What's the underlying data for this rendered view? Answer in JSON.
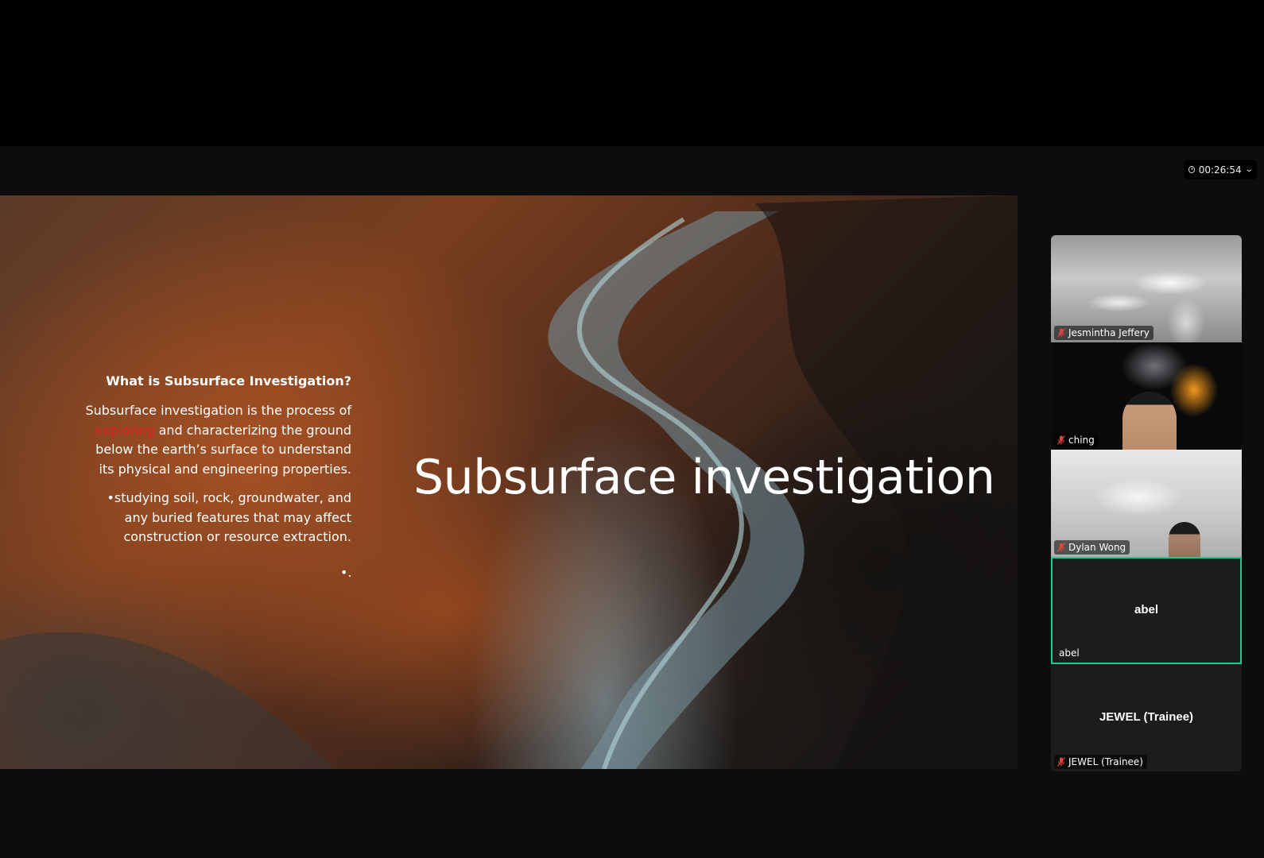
{
  "meeting": {
    "timer": "00:26:54"
  },
  "slide": {
    "title": "Subsurface investigation",
    "heading": "What is Subsurface Investigation?",
    "para1_pre": "Subsurface investigation is the process of ",
    "para1_highlight": "exploring",
    "para1_post": " and characterizing the ground below the earth’s surface to understand its physical and engineering properties.",
    "para2": "•studying soil, rock, groundwater, and any buried features that may affect construction or resource extraction.",
    "para3": "•.",
    "highlight_color": "#e02020"
  },
  "participants": [
    {
      "name": "Jesmintha Jeffery",
      "muted": true
    },
    {
      "name": "ching",
      "muted": true
    },
    {
      "name": "Dylan Wong",
      "muted": true
    },
    {
      "name": "abel",
      "center_label": "abel",
      "muted": false,
      "active_speaker": true
    },
    {
      "name": "JEWEL (Trainee)",
      "center_label": "JEWEL (Trainee)",
      "muted": true
    }
  ],
  "colors": {
    "active_border": "#23c98a",
    "muted_icon": "#e0453a"
  }
}
